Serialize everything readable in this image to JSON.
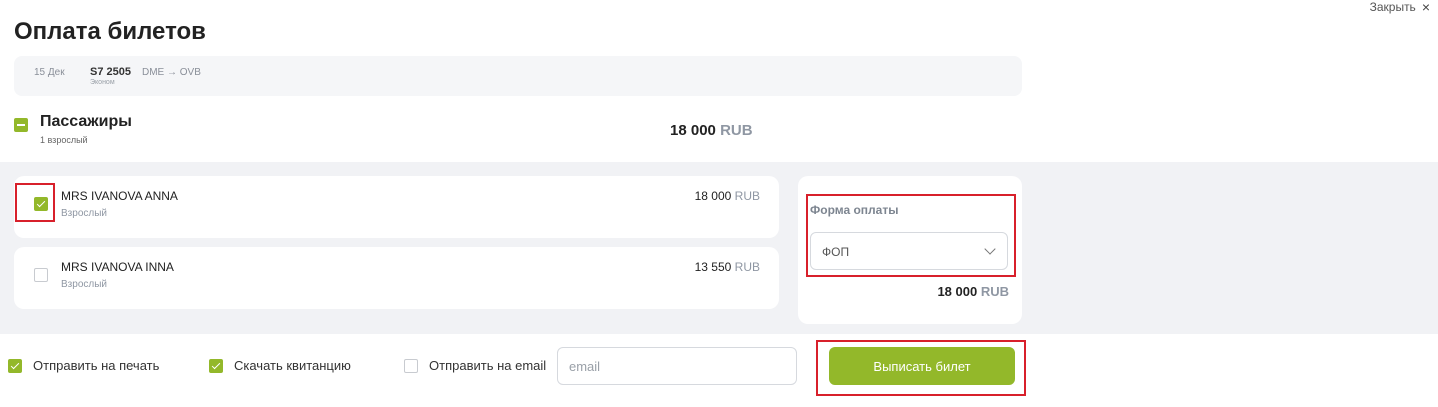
{
  "header": {
    "close_label": "Закрыть",
    "close_icon": "×",
    "title": "Оплата билетов"
  },
  "flight": {
    "date": "15 Дек",
    "number": "S7 2505",
    "class": "Эконом",
    "route": "DME → OVB"
  },
  "passengers_section": {
    "title": "Пассажиры",
    "count": "1 взрослый",
    "total_amount": "18 000",
    "total_currency": "RUB"
  },
  "passengers": [
    {
      "name": "MRS IVANOVA ANNA",
      "type": "Взрослый",
      "amount": "18 000",
      "currency": "RUB",
      "checked": true
    },
    {
      "name": "MRS IVANOVA INNA",
      "type": "Взрослый",
      "amount": "13 550",
      "currency": "RUB",
      "checked": false
    }
  ],
  "payment": {
    "label": "Форма оплаты",
    "selected": "ФОП",
    "total_amount": "18 000",
    "total_currency": "RUB"
  },
  "options": {
    "print_label": "Отправить на печать",
    "print_checked": true,
    "receipt_label": "Скачать квитанцию",
    "receipt_checked": true,
    "email_label": "Отправить на email",
    "email_checked": false,
    "email_placeholder": "email"
  },
  "actions": {
    "issue_label": "Выписать билет"
  },
  "colors": {
    "accent": "#93b82a",
    "highlight": "#d8202b",
    "panel_bg": "#f1f2f5"
  }
}
